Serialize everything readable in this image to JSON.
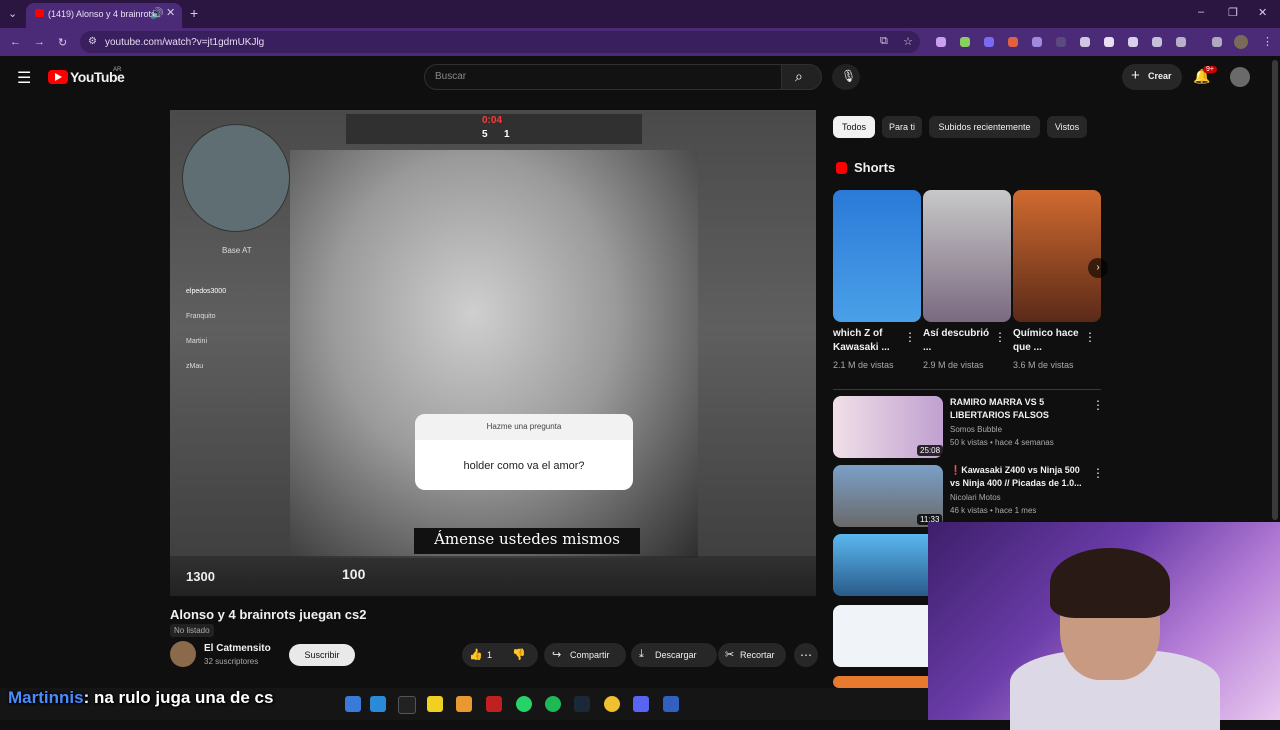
{
  "browser": {
    "tab_title": "(1419) Alonso y 4 brainrots",
    "url": "youtube.com/watch?v=jt1gdmUKJlg"
  },
  "header": {
    "logo": "YouTube",
    "logo_country": "AR",
    "search_placeholder": "Buscar",
    "create_label": "Crear",
    "notifications_badge": "9+"
  },
  "video": {
    "title": "Alonso y 4 brainrots juegan cs2",
    "visibility": "No listado",
    "timer": "0:04",
    "score_left": "5",
    "score_right": "1",
    "minimap_label": "Base AT",
    "player_names": [
      "elpedos3000",
      "Franquito",
      "Martini",
      "zMau"
    ],
    "question_header": "Hazme una pregunta",
    "question_text": "holder como va el amor?",
    "caption": "Ámense ustedes mismos",
    "money": "1300",
    "health": "100",
    "channel": {
      "name": "El Catmensito",
      "subscribers": "32 suscriptores",
      "subscribe_label": "Suscribir"
    },
    "actions": {
      "likes": "1",
      "share": "Compartir",
      "download": "Descargar",
      "clip": "Recortar"
    }
  },
  "sidebar": {
    "chips": [
      "Todos",
      "Para ti",
      "Subidos recientemente",
      "Vistos"
    ],
    "shorts_heading": "Shorts",
    "shorts": [
      {
        "title": "which Z of Kawasaki ...",
        "views": "2.1 M de vistas"
      },
      {
        "title": "Así descubrió ...",
        "views": "2.9 M de vistas"
      },
      {
        "title": "Químico hace que ...",
        "views": "3.6 M de vistas"
      }
    ],
    "recommendations": [
      {
        "title": "RAMIRO MARRA VS 5 LIBERTARIOS FALSOS",
        "channel": "Somos Bubble",
        "meta": "50 k vistas • hace 4 semanas",
        "duration": "25:08"
      },
      {
        "title": "❗Kawasaki Z400 vs Ninja 500 vs Ninja 400 // Picadas de 1.0...",
        "channel": "Nicolari Motos",
        "meta": "46 k vistas • hace 1 mes",
        "duration": "11:33"
      }
    ]
  },
  "overlay": {
    "chat_user": "Martinnis",
    "chat_message": ": na rulo juga una de cs"
  },
  "colors": {
    "accent_red": "#ff0000",
    "browser_purple": "#4b2a78"
  }
}
